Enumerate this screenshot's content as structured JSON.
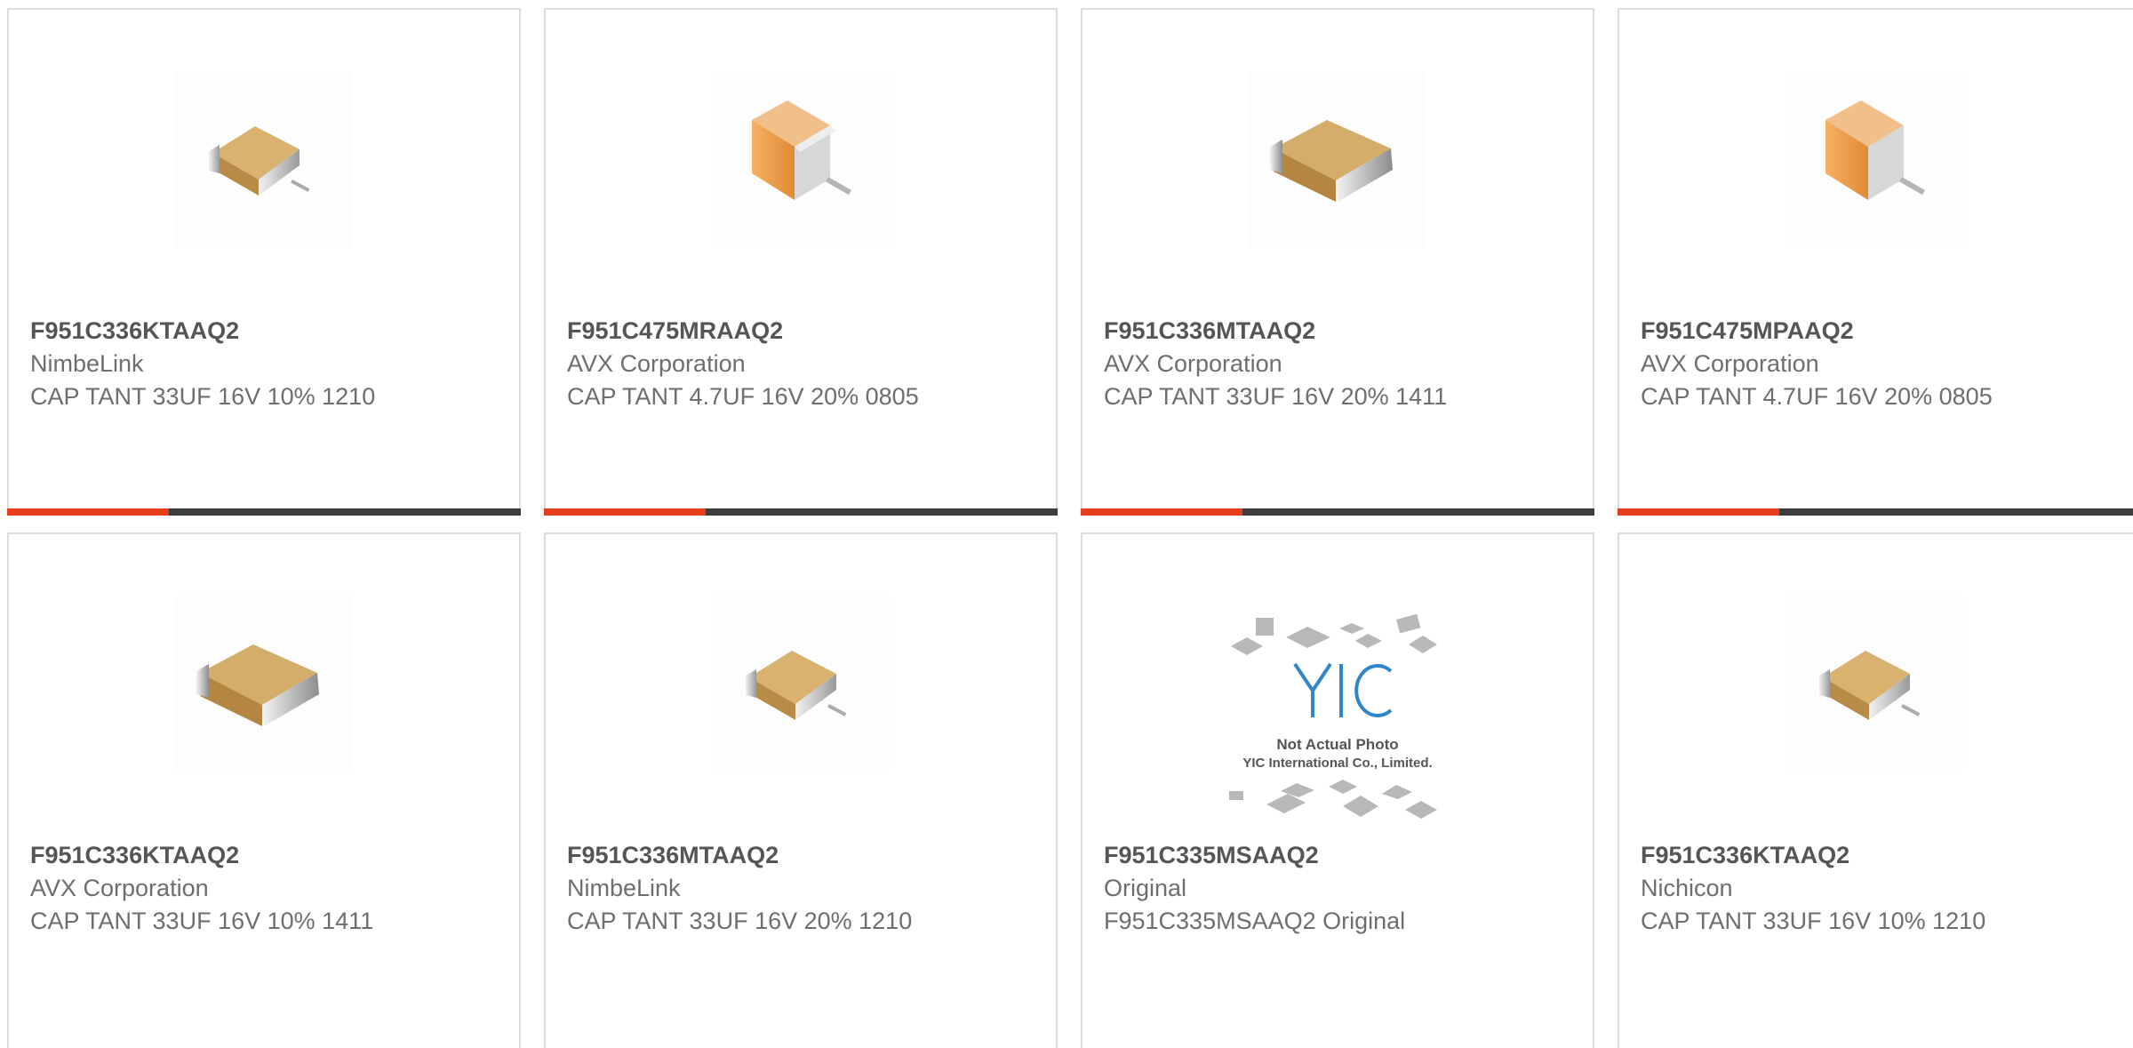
{
  "theme": {
    "accent": "#e8401c",
    "bar": "#3d3d3d"
  },
  "cards": [
    {
      "part": "F951C336KTAAQ2",
      "maker": "NimbeLink",
      "desc": "CAP TANT 33UF 16V 10% 1210",
      "image": "tantalum-chip-small-icon"
    },
    {
      "part": "F951C475MRAAQ2",
      "maker": "AVX Corporation",
      "desc": "CAP TANT 4.7UF 16V 20% 0805",
      "image": "tantalum-chip-orange-icon"
    },
    {
      "part": "F951C336MTAAQ2",
      "maker": "AVX Corporation",
      "desc": "CAP TANT 33UF 16V 20% 1411",
      "image": "tantalum-chip-large-icon"
    },
    {
      "part": "F951C475MPAAQ2",
      "maker": "AVX Corporation",
      "desc": "CAP TANT 4.7UF 16V 20% 0805",
      "image": "tantalum-chip-orange-icon"
    },
    {
      "part": "F951C336KTAAQ2",
      "maker": "AVX Corporation",
      "desc": "CAP TANT 33UF 16V 10% 1411",
      "image": "tantalum-chip-large-icon"
    },
    {
      "part": "F951C336MTAAQ2",
      "maker": "NimbeLink",
      "desc": "CAP TANT 33UF 16V 20% 1210",
      "image": "tantalum-chip-small-icon"
    },
    {
      "part": "F951C335MSAAQ2",
      "maker": "Original",
      "desc": "F951C335MSAAQ2 Original",
      "image": "not-actual-photo-placeholder",
      "placeholder": {
        "logo": "YIC",
        "line1": "Not Actual Photo",
        "line2": "YIC International Co., Limited."
      }
    },
    {
      "part": "F951C336KTAAQ2",
      "maker": "Nichicon",
      "desc": "CAP TANT 33UF 16V 10% 1210",
      "image": "tantalum-chip-small-icon"
    }
  ]
}
